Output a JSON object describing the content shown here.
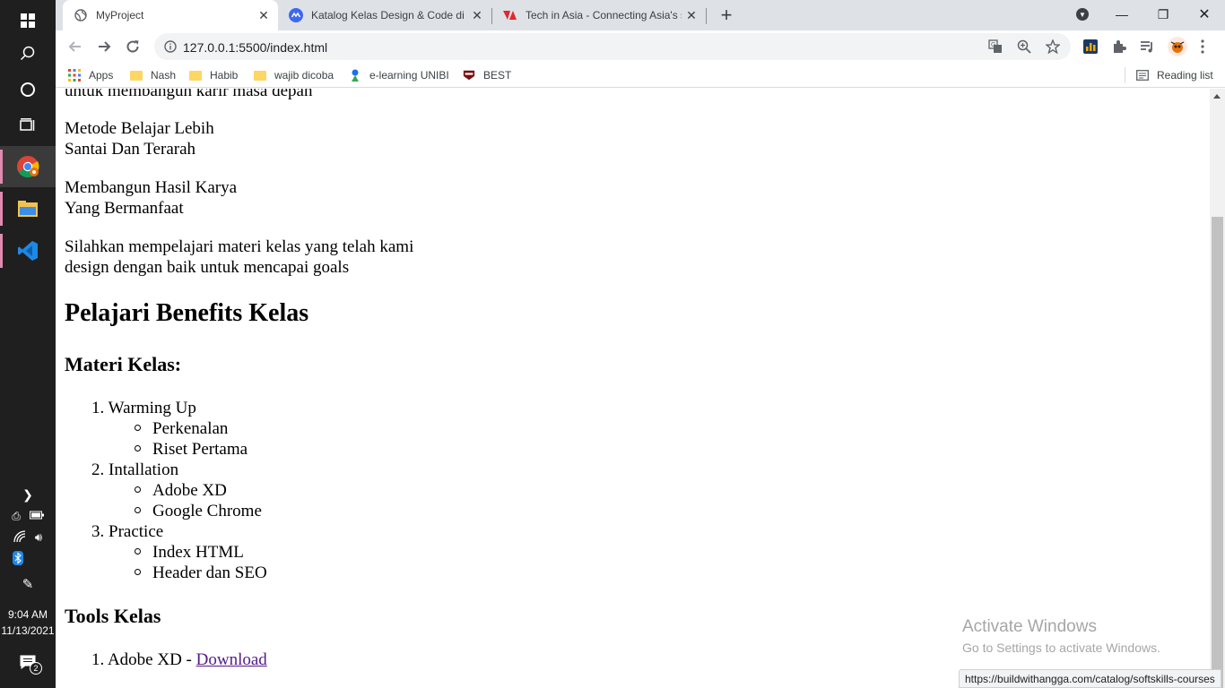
{
  "taskbar": {
    "time": "9:04 AM",
    "date": "11/13/2021",
    "notification_count": "2"
  },
  "browser": {
    "tabs": [
      {
        "title": "MyProject",
        "active": true
      },
      {
        "title": "Katalog Kelas Design & Code di BuildWith Angga",
        "active": false
      },
      {
        "title": "Tech in Asia - Connecting Asia's startup ecosystem",
        "active": false
      }
    ],
    "url": "127.0.0.1:5500/index.html",
    "bookmarks": [
      "Apps",
      "Nash",
      "Habib",
      "wajib dicoba",
      "e-learning UNIBI",
      "BEST"
    ],
    "reading_list": "Reading list",
    "status_url": "https://buildwithangga.com/catalog/softskills-courses"
  },
  "page": {
    "cut_line": "untuk membangun karir masa depan",
    "p1": [
      "Metode Belajar Lebih",
      "Santai Dan Terarah"
    ],
    "p2": [
      "Membangun Hasil Karya",
      "Yang Bermanfaat"
    ],
    "p3": [
      "Silahkan mempelajari materi kelas yang telah kami",
      "design dengan baik untuk mencapai goals"
    ],
    "benefits_title": "Pelajari Benefits Kelas",
    "materi_title": "Materi Kelas:",
    "materi": [
      {
        "num": "1.",
        "label": "Warming Up",
        "sub": [
          "Perkenalan",
          "Riset Pertama"
        ]
      },
      {
        "num": "2.",
        "label": "Intallation",
        "sub": [
          "Adobe XD",
          "Google Chrome"
        ]
      },
      {
        "num": "3.",
        "label": "Practice",
        "sub": [
          "Index HTML",
          "Header dan SEO"
        ]
      }
    ],
    "tools_title": "Tools Kelas",
    "tools": [
      {
        "num": "1.",
        "label": "Adobe XD - ",
        "link": "Download"
      }
    ]
  },
  "watermark": {
    "title": "Activate Windows",
    "subtitle": "Go to Settings to activate Windows."
  }
}
